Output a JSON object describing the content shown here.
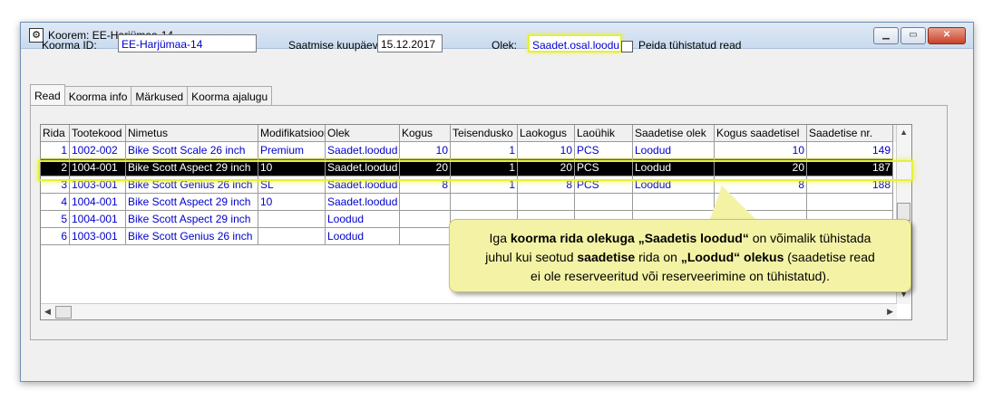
{
  "window": {
    "title": "Koorem: EE-Harjümaa-14",
    "buttons": [
      "minimize",
      "maximize",
      "close"
    ]
  },
  "form": {
    "koorma_id_label": "Koorma ID:",
    "koorma_id_value": "EE-Harjümaa-14",
    "saatmise_label": "Saatmise kuupäev:",
    "saatmise_value": "15.12.2017",
    "olek_label": "Olek:",
    "olek_value": "Saadet.osal.loodu",
    "peida_label": "Peida tühistatud read",
    "peida_checked": false
  },
  "tabs": [
    "Read",
    "Koorma info",
    "Märkused",
    "Koorma ajalugu"
  ],
  "grid": {
    "columns": [
      "Rida",
      "Tootekood",
      "Nimetus",
      "Modifikatsioon",
      "Olek",
      "Kogus",
      "Teisendusko",
      "Laokogus",
      "Laoühik",
      "Saadetise olek",
      "Kogus saadetisel",
      "Saadetise nr."
    ],
    "rows": [
      [
        "1",
        "1002-002",
        "Bike Scott Scale 26 inch",
        "Premium",
        "Saadet.loodud",
        "10",
        "1",
        "10",
        "PCS",
        "Loodud",
        "10",
        "149"
      ],
      [
        "2",
        "1004-001",
        "Bike Scott Aspect 29 inch",
        "10",
        "Saadet.loodud",
        "20",
        "1",
        "20",
        "PCS",
        "Loodud",
        "20",
        "187"
      ],
      [
        "3",
        "1003-001",
        "Bike Scott Genius 26 inch",
        "SL",
        "Saadet.loodud",
        "8",
        "1",
        "8",
        "PCS",
        "Loodud",
        "8",
        "188"
      ],
      [
        "4",
        "1004-001",
        "Bike Scott Aspect 29 inch",
        "10",
        "Saadet.loodud",
        "",
        "",
        "",
        "",
        "",
        "",
        ""
      ],
      [
        "5",
        "1004-001",
        "Bike Scott Aspect 29 inch",
        "",
        "Loodud",
        "",
        "",
        "",
        "",
        "",
        "",
        ""
      ],
      [
        "6",
        "1003-001",
        "Bike Scott Genius 26 inch",
        "",
        "Loodud",
        "",
        "",
        "",
        "",
        "",
        "",
        ""
      ]
    ],
    "selected_row": 2
  },
  "callout": {
    "line1_a": "Iga ",
    "line1_b": "koorma rida olekuga „Saadetis loodud“",
    "line1_c": " on võimalik tühistada",
    "line2_a": "juhul kui seotud ",
    "line2_b": "saadetise",
    "line2_c": " rida on ",
    "line2_d": "„Loodud“ olekus",
    "line2_e": " (saadetise read",
    "line3": "ei ole reserveeritud või reserveerimine on tühistatud)."
  },
  "colors": {
    "accent_blue": "#0000cc",
    "highlight": "#e6f03c",
    "callout_bg": "#f4f3a5"
  }
}
